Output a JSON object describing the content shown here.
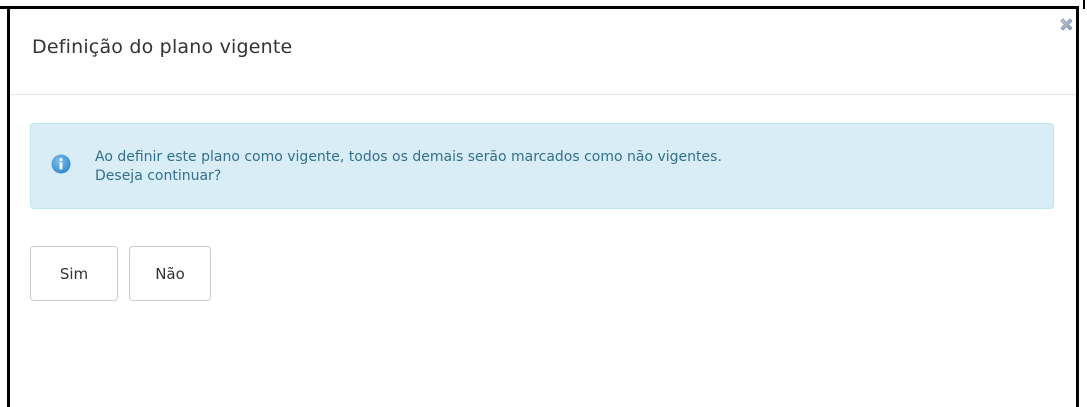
{
  "dialog": {
    "title": "Definição do plano vigente",
    "close_icon": "close-x-icon",
    "alert": {
      "icon": "info-circle-icon",
      "line1": "Ao definir este plano como vigente, todos os demais serão marcados como não vigentes.",
      "line2": "Deseja continuar?",
      "colors": {
        "background": "#d9edf7",
        "border": "#bce8f1",
        "text": "#31708f",
        "icon": "#3a9ad9"
      }
    },
    "buttons": {
      "yes_label": "Sim",
      "no_label": "Não"
    }
  }
}
